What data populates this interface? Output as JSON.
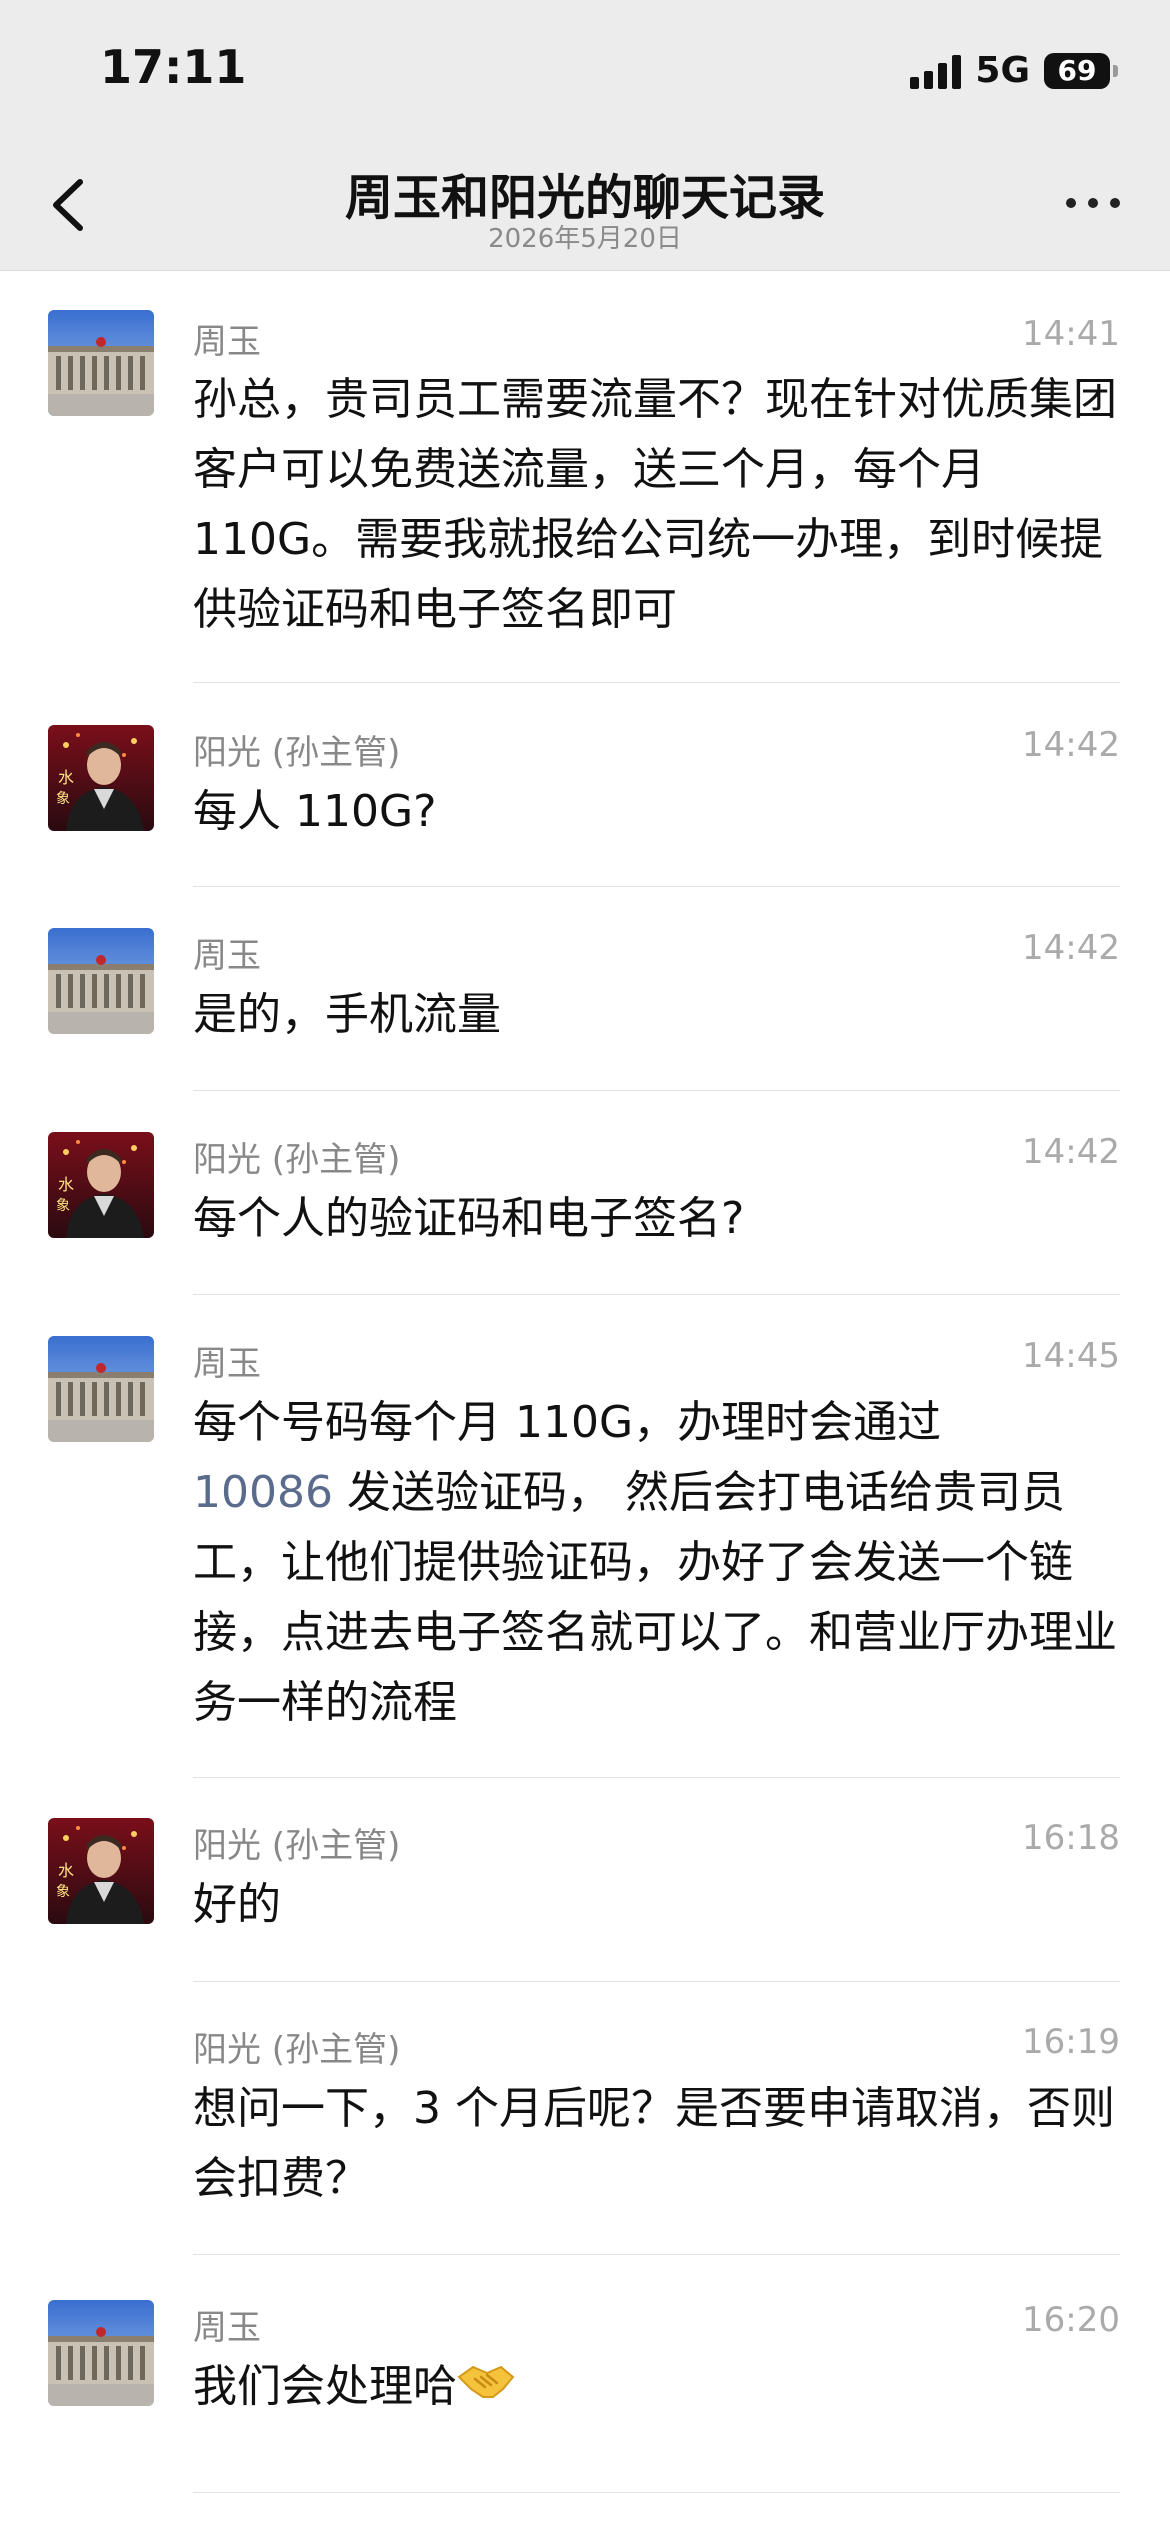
{
  "status_bar": {
    "time": "17:11",
    "network": "5G",
    "battery": "69"
  },
  "nav": {
    "title": "周玉和阳光的聊天记录",
    "date": "2026年5月20日"
  },
  "colors": {
    "link": "#5a6b8c",
    "sender": "#888888",
    "timestamp": "#aaaaaa",
    "header_bg": "#ececec"
  },
  "messages": [
    {
      "sender": "周玉",
      "time": "14:41",
      "avatar": "building-avatar",
      "text": "孙总，贵司员工需要流量不？现在针对优质集团客户可以免费送流量，送三个月，每个月 110G。需要我就报给公司统一办理，到时候提供验证码和电子签名即可"
    },
    {
      "sender": "阳光 (孙主管)",
      "time": "14:42",
      "avatar": "person-avatar",
      "text": "每人 110G?"
    },
    {
      "sender": "周玉",
      "time": "14:42",
      "avatar": "building-avatar",
      "text": "是的，手机流量"
    },
    {
      "sender": "阳光 (孙主管)",
      "time": "14:42",
      "avatar": "person-avatar",
      "text": "每个人的验证码和电子签名?"
    },
    {
      "sender": "周玉",
      "time": "14:45",
      "avatar": "building-avatar",
      "text_before": "每个号码每个月 110G，办理时会通过",
      "link": "10086",
      "text_after": " 发送验证码， 然后会打电话给贵司员工，让他们提供验证码，办好了会发送一个链接，点进去电子签名就可以了。和营业厅办理业务一样的流程"
    },
    {
      "sender": "阳光 (孙主管)",
      "time": "16:18",
      "avatar": "person-avatar",
      "text": "好的"
    },
    {
      "sender": "阳光 (孙主管)",
      "time": "16:19",
      "avatar": "",
      "text": "想问一下，3 个月后呢？是否要申请取消，否则会扣费？"
    },
    {
      "sender": "周玉",
      "time": "16:20",
      "avatar": "building-avatar",
      "text": "我们会处理哈",
      "emoji": "handshake-emoji"
    }
  ]
}
